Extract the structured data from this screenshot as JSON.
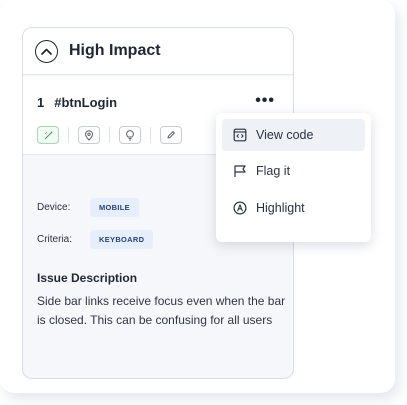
{
  "panel": {
    "title": "High Impact"
  },
  "issue": {
    "number": "1",
    "selector": "#btnLogin",
    "more_label": "•••",
    "action_icons": [
      "wand-icon",
      "location-pin-icon",
      "lightbulb-icon",
      "pencil-icon"
    ]
  },
  "meta": {
    "device_label": "Device:",
    "device_value": "MOBILE",
    "criteria_label": "Criteria:",
    "criteria_value": "KEYBOARD"
  },
  "description": {
    "title": "Issue Description",
    "body": "Side bar links receive focus even when the bar is closed. This can be confusing for all users"
  },
  "menu": {
    "items": [
      {
        "label": "View code",
        "icon": "code-window-icon"
      },
      {
        "label": "Flag it",
        "icon": "flag-icon"
      },
      {
        "label": "Highlight",
        "icon": "highlight-icon"
      }
    ]
  },
  "colors": {
    "accent_chip_bg": "#e6eefc",
    "chip_text": "#28427a",
    "card_bg": "#f6f7fa"
  }
}
